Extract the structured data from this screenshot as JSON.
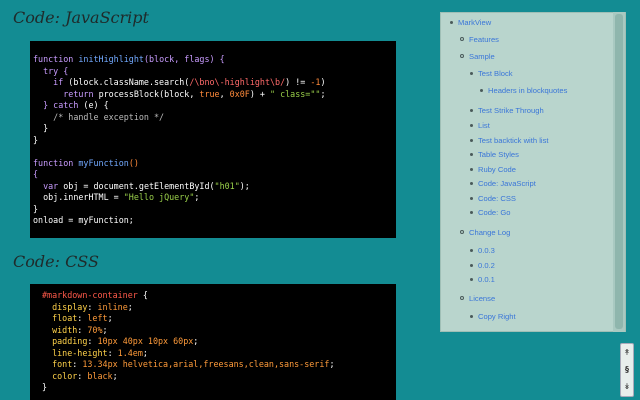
{
  "headings": {
    "javascript": "Code: JavaScript",
    "css": "Code: CSS"
  },
  "code_blocks": {
    "javascript": [
      [
        [
          "function ",
          "kw"
        ],
        [
          "initHighlight",
          "fn"
        ],
        [
          "(block, flags) {",
          "kw"
        ]
      ],
      [
        [
          "  try {",
          "kw"
        ]
      ],
      [
        [
          "    if ",
          "kw"
        ],
        [
          "(block.className.search(",
          "plain"
        ],
        [
          "/\\bno\\-highlight\\b/",
          "re"
        ],
        [
          ") != ",
          "plain"
        ],
        [
          "-1",
          "num"
        ],
        [
          ")",
          "plain"
        ]
      ],
      [
        [
          "      return ",
          "kw"
        ],
        [
          "processBlock(block, ",
          "plain"
        ],
        [
          "true",
          "num"
        ],
        [
          ", ",
          "plain"
        ],
        [
          "0x0F",
          "num"
        ],
        [
          ") + ",
          "plain"
        ],
        [
          "\" class=\"\"",
          "str"
        ],
        [
          ";",
          "plain"
        ]
      ],
      [
        [
          "  } catch ",
          "kw"
        ],
        [
          "(e) {",
          "plain"
        ]
      ],
      [
        [
          "    /* handle exception */",
          "com"
        ]
      ],
      [
        [
          "  }",
          "plain"
        ]
      ],
      [
        [
          "}",
          "plain"
        ]
      ],
      [
        [
          "",
          "plain"
        ]
      ],
      [
        [
          "function ",
          "kw"
        ],
        [
          "myFunction",
          "fn"
        ],
        [
          "()",
          "num"
        ]
      ],
      [
        [
          "{",
          "kw"
        ]
      ],
      [
        [
          "  var ",
          "kw"
        ],
        [
          "obj = document.getElementById(",
          "plain"
        ],
        [
          "\"h01\"",
          "str"
        ],
        [
          ");",
          "plain"
        ]
      ],
      [
        [
          "  obj.innerHTML = ",
          "plain"
        ],
        [
          "\"Hello jQuery\"",
          "str"
        ],
        [
          ";",
          "plain"
        ]
      ],
      [
        [
          "}",
          "plain"
        ]
      ],
      [
        [
          "onload = myFunction;",
          "plain"
        ]
      ]
    ],
    "css": [
      [
        [
          "#markdown-container ",
          "sel"
        ],
        [
          "{",
          "plain"
        ]
      ],
      [
        [
          "  display",
          "prop"
        ],
        [
          ": ",
          "plain"
        ],
        [
          "inline",
          "val"
        ],
        [
          ";",
          "plain"
        ]
      ],
      [
        [
          "  float",
          "prop"
        ],
        [
          ": ",
          "plain"
        ],
        [
          "left",
          "val"
        ],
        [
          ";",
          "plain"
        ]
      ],
      [
        [
          "  width",
          "prop"
        ],
        [
          ": ",
          "plain"
        ],
        [
          "70%",
          "val"
        ],
        [
          ";",
          "plain"
        ]
      ],
      [
        [
          "  padding",
          "prop"
        ],
        [
          ": ",
          "plain"
        ],
        [
          "10px 40px 10px 60px",
          "val"
        ],
        [
          ";",
          "plain"
        ]
      ],
      [
        [
          "  line-height",
          "prop"
        ],
        [
          ": ",
          "plain"
        ],
        [
          "1.4em",
          "val"
        ],
        [
          ";",
          "plain"
        ]
      ],
      [
        [
          "  font",
          "prop"
        ],
        [
          ": ",
          "plain"
        ],
        [
          "13.34px helvetica,arial,freesans,clean,sans-serif",
          "val"
        ],
        [
          ";",
          "plain"
        ]
      ],
      [
        [
          "  color",
          "prop"
        ],
        [
          ": ",
          "plain"
        ],
        [
          "black",
          "val"
        ],
        [
          ";",
          "plain"
        ]
      ],
      [
        [
          "}",
          "plain"
        ]
      ]
    ]
  },
  "toc": {
    "items": [
      {
        "label": "MarkView",
        "level": 0
      },
      {
        "label": "Features",
        "level": 1
      },
      {
        "label": "Sample",
        "level": 1
      },
      {
        "label": "Test Block",
        "level": 2
      },
      {
        "label": "Headers in blockquotes",
        "level": 3
      },
      {
        "label": "Test Strike Through",
        "level": 2
      },
      {
        "label": "List",
        "level": 2
      },
      {
        "label": "Test backtick with list",
        "level": 2
      },
      {
        "label": "Table Styles",
        "level": 2
      },
      {
        "label": "Ruby Code",
        "level": 2
      },
      {
        "label": "Code: JavaScript",
        "level": 2
      },
      {
        "label": "Code: CSS",
        "level": 2
      },
      {
        "label": "Code: Go",
        "level": 2
      },
      {
        "label": "Change Log",
        "level": 1
      },
      {
        "label": "0.0.3",
        "level": 2
      },
      {
        "label": "0.0.2",
        "level": 2
      },
      {
        "label": "0.0.1",
        "level": 2
      },
      {
        "label": "License",
        "level": 1
      },
      {
        "label": "Copy Right",
        "level": 2
      }
    ]
  },
  "nav_buttons": {
    "top": "↟",
    "toc": "§",
    "bottom": "↡"
  },
  "colors": {
    "page_background": "#138c93",
    "toc_background": "#b9d5cd",
    "toc_link": "#3a76d8",
    "code_background": "#000000"
  }
}
